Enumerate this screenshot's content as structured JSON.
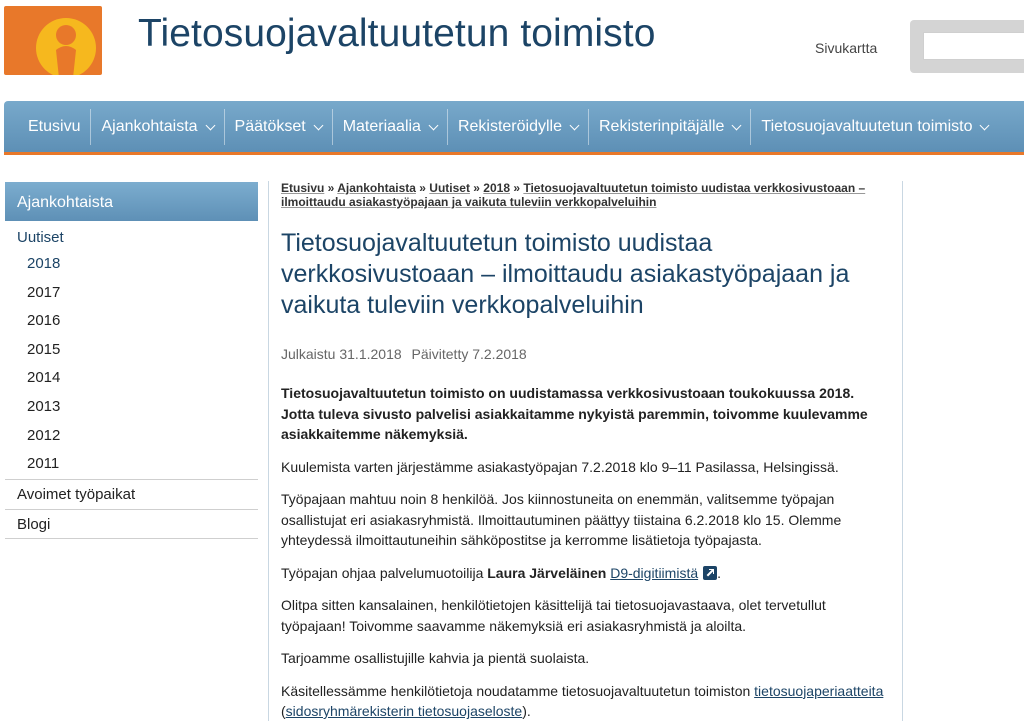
{
  "header": {
    "site_title": "Tietosuojavaltuutetun toimisto",
    "sitemap_label": "Sivukartta",
    "search_value": "",
    "brand_color": "#e8782a",
    "title_color": "#1c4466"
  },
  "nav": {
    "items": [
      {
        "label": "Etusivu",
        "dropdown": false
      },
      {
        "label": "Ajankohtaista",
        "dropdown": true
      },
      {
        "label": "Päätökset",
        "dropdown": true
      },
      {
        "label": "Materiaalia",
        "dropdown": true
      },
      {
        "label": "Rekisteröidylle",
        "dropdown": true
      },
      {
        "label": "Rekisterinpitäjälle",
        "dropdown": true
      },
      {
        "label": "Tietosuojavaltuutetun toimisto",
        "dropdown": true
      }
    ]
  },
  "sidebar": {
    "heading": "Ajankohtaista",
    "sub": "Uutiset",
    "years": [
      "2018",
      "2017",
      "2016",
      "2015",
      "2014",
      "2013",
      "2012",
      "2011"
    ],
    "active_year": "2018",
    "links": [
      "Avoimet työpaikat",
      "Blogi"
    ]
  },
  "breadcrumb": {
    "items": [
      "Etusivu",
      "Ajankohtaista",
      "Uutiset",
      "2018",
      "Tietosuojavaltuutetun toimisto uudistaa verkkosivustoaan – ilmoittaudu asiakastyöpajaan ja vaikuta tuleviin verkkopalveluihin"
    ],
    "separator": " » "
  },
  "article": {
    "title": "Tietosuojavaltuutetun toimisto uudistaa verkkosivustoaan – ilmoittaudu asiakastyöpajaan ja vaikuta tuleviin verkkopalveluihin",
    "published": "Julkaistu 31.1.2018",
    "updated": "Päivitetty 7.2.2018",
    "lead": "Tietosuojavaltuutetun toimisto on uudistamassa verkkosivustoaan toukokuussa 2018. Jotta tuleva sivusto palvelisi asiakkaitamme nykyistä paremmin, toivomme kuulevamme asiakkaitemme näkemyksiä.",
    "p1": "Kuulemista varten järjestämme asiakastyöpajan 7.2.2018 klo 9–11 Pasilassa, Helsingissä.",
    "p2": "Työpajaan mahtuu noin 8 henkilöä. Jos kiinnostuneita on enemmän, valitsemme työpajan osallistujat eri asiakasryhmistä. Ilmoittautuminen päättyy tiistaina 6.2.2018 klo 15. Olemme yhteydessä ilmoittautuneihin sähköpostitse ja kerromme lisätietoja työpajasta.",
    "p3_pre": "Työpajan ohjaa palvelumuotoilija ",
    "p3_name": "Laura Järveläinen",
    "p3_link": "D9-digitiimistä",
    "p3_post": ".",
    "p4": "Olitpa sitten kansalainen, henkilötietojen käsittelijä tai tietosuojavastaava, olet tervetullut työpajaan! Toivomme saavamme näkemyksiä eri asiakasryhmistä ja aloilta.",
    "p5": "Tarjoamme osallistujille kahvia ja pientä suolaista.",
    "p6_pre": "Käsitellessämme henkilötietoja noudatamme tietosuojavaltuutetun toimiston ",
    "p6_link1": "tietosuojaperiaatteita",
    "p6_mid": " (",
    "p6_link2": "sidosryhmärekisterin tietosuojaseloste",
    "p6_post": ")."
  }
}
